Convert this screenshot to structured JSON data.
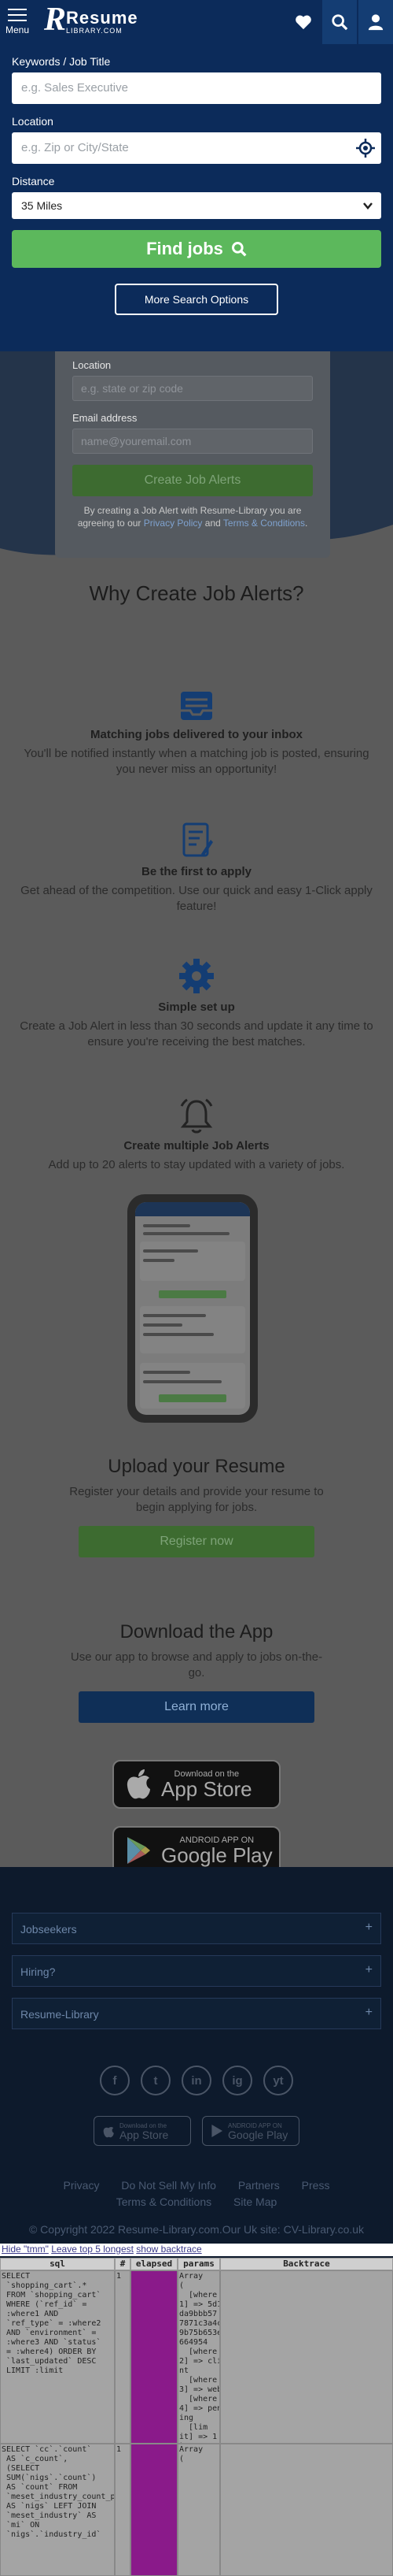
{
  "header": {
    "menu_label": "Menu",
    "logo_main": "Resume",
    "logo_sub": "LIBRARY.COM",
    "icons": [
      "heart-icon",
      "search-icon",
      "user-icon"
    ]
  },
  "search": {
    "keywords_label": "Keywords / Job Title",
    "keywords_placeholder": "e.g. Sales Executive",
    "location_label": "Location",
    "location_placeholder": "e.g. Zip or City/State",
    "distance_label": "Distance",
    "distance_value": "35 Miles",
    "find_button": "Find jobs",
    "more_options": "More Search Options"
  },
  "alert_form": {
    "location_label": "Location",
    "location_placeholder": "e.g. state or zip code",
    "email_label": "Email address",
    "email_placeholder": "name@youremail.com",
    "create_button": "Create Job Alerts",
    "legal_line1": "By creating a Job Alert with Resume-Library you are",
    "legal_line2": "agreeing to our ",
    "privacy": "Privacy Policy",
    "and": " and ",
    "terms": "Terms & Conditions",
    "legal_end": "."
  },
  "why": {
    "heading": "Why Create Job Alerts?",
    "features": [
      {
        "icon": "inbox-icon",
        "title": "Matching jobs delivered to your inbox",
        "desc": "You'll be notified instantly when a matching job is posted, ensuring you never miss an opportunity!"
      },
      {
        "icon": "document-edit-icon",
        "title": "Be the first to apply",
        "desc": "Get ahead of the competition. Use our quick and easy 1-Click apply feature!"
      },
      {
        "icon": "gear-icon",
        "title": "Simple set up",
        "desc": "Create a Job Alert in less than 30 seconds and update it any time to ensure you're receiving the best matches."
      },
      {
        "icon": "bell-icon",
        "title": "Create multiple Job Alerts",
        "desc": "Add up to 20 alerts to stay updated with a variety of jobs."
      }
    ]
  },
  "upload": {
    "heading": "Upload your Resume",
    "text": "Register your details and provide your resume to begin applying for jobs.",
    "button": "Register now"
  },
  "app": {
    "heading": "Download the App",
    "text": "Use our app to browse and apply to jobs on-the-go.",
    "button": "Learn more",
    "appstore_small": "Download on the",
    "appstore_big": "App Store",
    "google_small": "ANDROID APP ON",
    "google_big": "Google Play"
  },
  "footer": {
    "accordions": [
      "Jobseekers",
      "Hiring?",
      "Resume-Library"
    ],
    "social": [
      "f",
      "t",
      "in",
      "ig",
      "yt"
    ],
    "links_row1": [
      "Privacy",
      "Do Not Sell My Info",
      "Partners",
      "Press"
    ],
    "links_row2": [
      "Terms & Conditions",
      "Site Map"
    ],
    "copyright": "© Copyright 2022 Resume-Library.com.Our Uk site: CV-Library.co.uk"
  },
  "debug": {
    "bar_hide": "Hide \"tmm\"",
    "bar_leave": "Leave top 5 longest",
    "bar_show": "show backtrace",
    "headers": [
      "sql",
      "#",
      "elapsed",
      "params",
      "Backtrace"
    ],
    "row1_sql": "SELECT\n `shopping_cart`.*\n FROM `shopping_cart`\n WHERE (`ref_id` =\n :where1 AND\n `ref_type` = :where2\n AND `environment` =\n :where3 AND `status`\n = :where4) ORDER BY\n `last_updated` DESC\n LIMIT :limit",
    "row1_n": "1",
    "row1_params": "Array\n(\n  [where\n1] => 5d1\nda9bbb57\n7871c3a4c\n9b75b653e\n664954\n  [where\n2] => clie\nnt\n  [where\n3] => web\n  [where\n4] => pend\ning\n  [lim\nit] => 1\n)",
    "row2_sql": "SELECT `cc`.`count`\n AS `c_count`,\n (SELECT\n SUM(`nigs`.`count`)\n AS `count` FROM\n `meset_industry_count_per\n AS `nigs` LEFT JOIN\n `meset_industry` AS\n `mi` ON\n `nigs`.`industry_id`",
    "row2_n": "1",
    "row2_params": "Array\n("
  }
}
